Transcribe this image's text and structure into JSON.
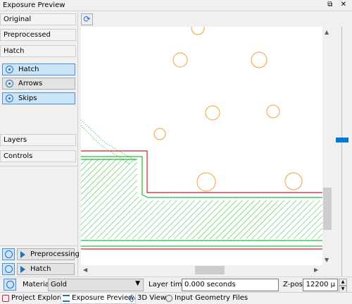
{
  "window": {
    "title": "Exposure Preview",
    "controls": "⧉ ✕"
  },
  "left_panel": {
    "sections": [
      {
        "label": "Original"
      },
      {
        "label": "Preprocessed"
      },
      {
        "label": "Hatch"
      }
    ],
    "hatch_toggles": [
      {
        "label": "Hatch",
        "active": true
      },
      {
        "label": "Arrows",
        "active": false
      },
      {
        "label": "Skips",
        "active": true
      }
    ],
    "lower_sections": [
      {
        "label": "Layers"
      },
      {
        "label": "Controls"
      }
    ],
    "action_buttons": [
      {
        "label": "Preprocessing"
      },
      {
        "label": "Hatch"
      }
    ]
  },
  "toolbar": {
    "refresh_icon": "refresh-icon"
  },
  "bottom_bar": {
    "material_label": "Material",
    "material_value": "Gold",
    "layer_time_label": "Layer time",
    "layer_time_value": "0.000 seconds",
    "zpos_label": "Z-pos",
    "zpos_value": "12200 µ"
  },
  "tabs": [
    {
      "label": "Project Explorer",
      "icon": "project-explorer-icon"
    },
    {
      "label": "Exposure Preview",
      "icon": "exposure-preview-icon",
      "active": true
    },
    {
      "label": "3D View",
      "icon": "cube-icon"
    },
    {
      "label": "Input Geometry Files",
      "icon": "input-files-icon"
    }
  ],
  "colors": {
    "circles": "#f0a030",
    "contour": "#cc2233",
    "hatch": "#22bb33",
    "accent": "#0078d7"
  }
}
